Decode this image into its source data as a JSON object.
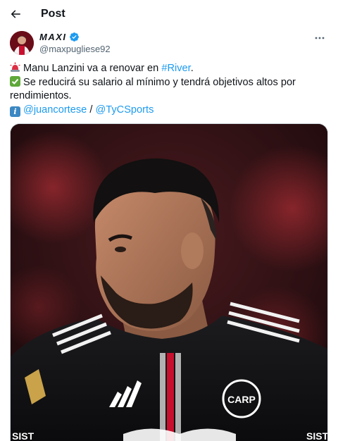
{
  "header": {
    "back_icon": "arrow-left-icon",
    "title": "Post"
  },
  "author": {
    "display_name": "MAXI",
    "handle": "@maxpugliese92",
    "verified_icon": "verified-badge-icon",
    "more_icon": "more-horizontal-icon"
  },
  "tweet": {
    "line1_text": "Manu Lanzini va a renovar en ",
    "line1_hashtag": "#River",
    "line1_end": ".",
    "line2_text": "Se reducirá su salario al mínimo y tendrá objetivos altos por rendimientos.",
    "line3_mention1": "@juancortese",
    "line3_sep": " / ",
    "line3_mention2": "@TyCSports",
    "emoji_icons": [
      "rotating-light-icon",
      "check-mark-button-icon",
      "information-icon"
    ]
  },
  "media": {
    "description_icon": "player-photo",
    "shirt_text_left": "SIST",
    "shirt_text_right": "SIST",
    "crest_text": "CARP"
  },
  "colors": {
    "text": "#0f1419",
    "secondary": "#536471",
    "link": "#1d9bf0",
    "verified": "#1d9bf0"
  }
}
